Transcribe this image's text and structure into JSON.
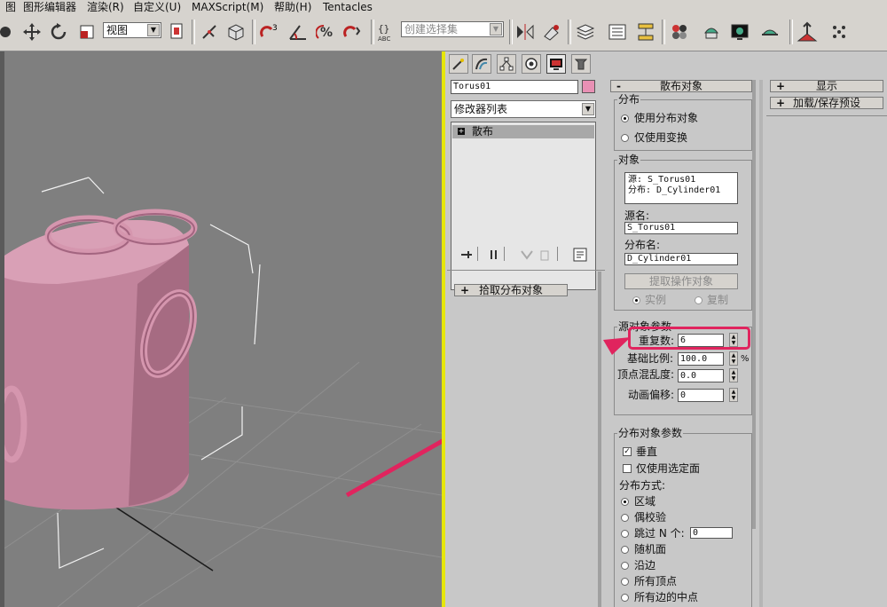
{
  "menubar": {
    "items": [
      "图",
      "图形编辑器",
      "渲染(R)",
      "自定义(U)",
      "MAXScript(M)",
      "帮助(H)",
      "Tentacles"
    ]
  },
  "toolbar": {
    "view_combo": "视图",
    "selection_set_placeholder": "创建选择集"
  },
  "panel": {
    "object_name": "Torus01",
    "object_color": "#e890b4",
    "modifier_list": "修改器列表",
    "stack_item": "散布",
    "pick_rollout": "拾取分布对象"
  },
  "scatter": {
    "rollout_title": "散布对象",
    "dist_group": "分布",
    "dist_opt1": "使用分布对象",
    "dist_opt2": "仅使用变换",
    "obj_group": "对象",
    "obj_list_line1": "源: S_Torus01",
    "obj_list_line2": "分布: D_Cylinder01",
    "src_name_label": "源名:",
    "src_name_value": "S_Torus01",
    "dist_name_label": "分布名:",
    "dist_name_value": "D_Cylinder01",
    "extract_button": "提取操作对象",
    "instance_label": "实例",
    "copy_label": "复制",
    "src_params_group": "源对象参数",
    "dup_label": "重复数:",
    "dup_value": "6",
    "base_scale_label": "基础比例:",
    "base_scale_value": "100.0",
    "base_scale_unit": "%",
    "vertex_chaos_label": "顶点混乱度:",
    "vertex_chaos_value": "0.0",
    "anim_offset_label": "动画偏移:",
    "anim_offset_value": "0",
    "dist_params_group": "分布对象参数",
    "perpendicular_label": "垂直",
    "selected_faces_label": "仅使用选定面",
    "dist_method_label": "分布方式:",
    "method_area": "区域",
    "method_even": "偶校验",
    "method_skip": "跳过 N 个:",
    "method_skip_value": "0",
    "method_random_faces": "随机面",
    "method_along_edges": "沿边",
    "method_all_vertices": "所有顶点",
    "method_all_edge_mid": "所有边的中点"
  },
  "right_rollouts": {
    "display": "显示",
    "load_save": "加载/保存预设"
  },
  "colors": {
    "viewport_bg": "#7f7f7f",
    "object_pink": "#c98aa3",
    "highlight": "#e0245e",
    "active_border": "#e6e60a"
  }
}
